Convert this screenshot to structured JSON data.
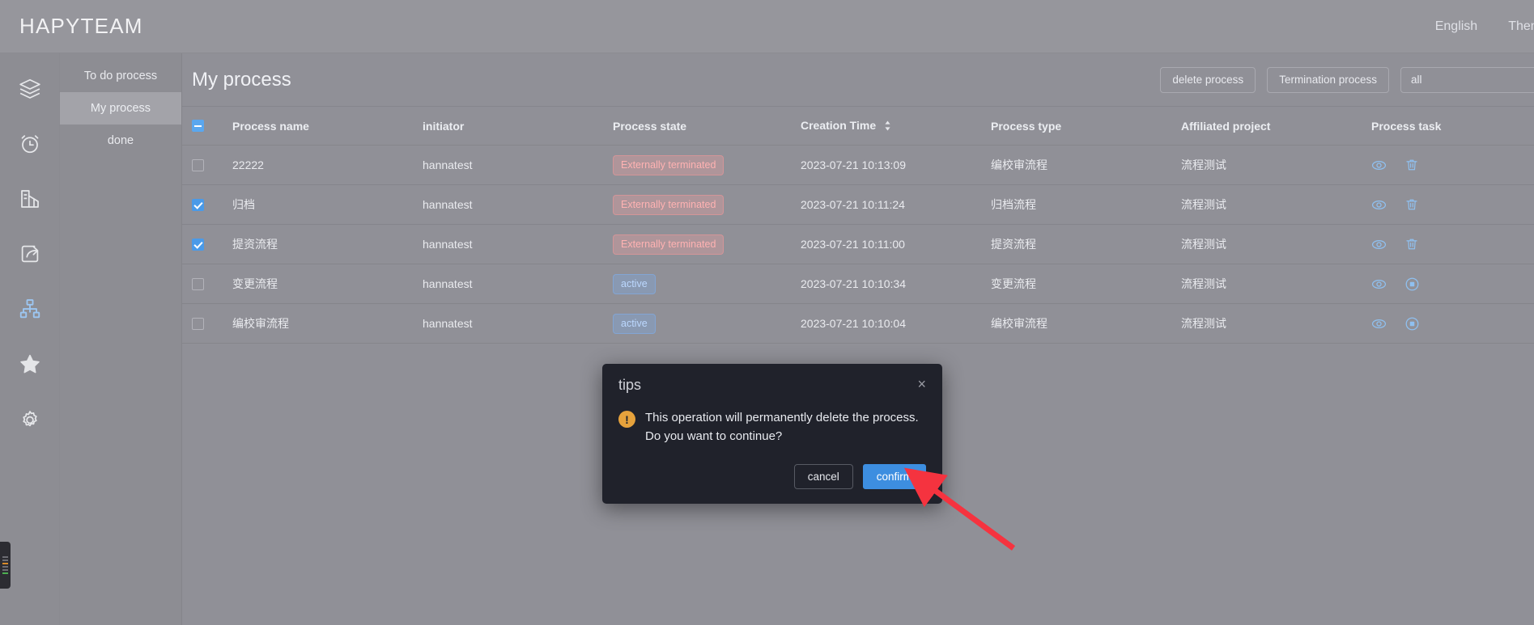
{
  "header": {
    "brand": "HAPYTEAM",
    "language_label": "English",
    "theme_label": "Theme"
  },
  "rail": {
    "items": [
      {
        "name": "layers-icon",
        "label": "layers"
      },
      {
        "name": "alarm-clock-icon",
        "label": "alarm clock"
      },
      {
        "name": "building-chart-icon",
        "label": "statistics"
      },
      {
        "name": "share-export-icon",
        "label": "share"
      },
      {
        "name": "sitemap-icon",
        "label": "process",
        "active": true
      },
      {
        "name": "star-icon",
        "label": "favorites"
      },
      {
        "name": "gear-icon",
        "label": "settings"
      }
    ]
  },
  "subnav": {
    "items": [
      {
        "label": "To do process",
        "active": false
      },
      {
        "label": "My process",
        "active": true
      },
      {
        "label": "done",
        "active": false
      }
    ]
  },
  "page": {
    "title": "My process",
    "actions": {
      "delete_process": "delete process",
      "termination_process": "Termination process"
    },
    "filter": {
      "selected": "all",
      "options": [
        "all"
      ]
    }
  },
  "table": {
    "columns": [
      "Process name",
      "initiator",
      "Process state",
      "Creation Time",
      "Process type",
      "Affiliated project",
      "Process task"
    ],
    "sort_column": "Creation Time",
    "header_checkbox_state": "indeterminate",
    "rows": [
      {
        "checked": false,
        "name": "22222",
        "initiator": "hannatest",
        "state": "Externally terminated",
        "state_kind": "terminated",
        "time": "2023-07-21 10:13:09",
        "type": "编校审流程",
        "project": "流程测试",
        "task_icons": [
          "eye-icon",
          "trash-icon"
        ]
      },
      {
        "checked": true,
        "name": "归档",
        "initiator": "hannatest",
        "state": "Externally terminated",
        "state_kind": "terminated",
        "time": "2023-07-21 10:11:24",
        "type": "归档流程",
        "project": "流程测试",
        "task_icons": [
          "eye-icon",
          "trash-icon"
        ]
      },
      {
        "checked": true,
        "name": "提资流程",
        "initiator": "hannatest",
        "state": "Externally terminated",
        "state_kind": "terminated",
        "time": "2023-07-21 10:11:00",
        "type": "提资流程",
        "project": "流程测试",
        "task_icons": [
          "eye-icon",
          "trash-icon"
        ]
      },
      {
        "checked": false,
        "name": "变更流程",
        "initiator": "hannatest",
        "state": "active",
        "state_kind": "active",
        "time": "2023-07-21 10:10:34",
        "type": "变更流程",
        "project": "流程测试",
        "task_icons": [
          "eye-icon",
          "stop-icon"
        ]
      },
      {
        "checked": false,
        "name": "编校审流程",
        "initiator": "hannatest",
        "state": "active",
        "state_kind": "active",
        "time": "2023-07-21 10:10:04",
        "type": "编校审流程",
        "project": "流程测试",
        "task_icons": [
          "eye-icon",
          "stop-icon"
        ]
      }
    ]
  },
  "modal": {
    "title": "tips",
    "close_icon": "×",
    "warning_icon": "!",
    "message": "This operation will permanently delete the process. Do you want to continue?",
    "cancel_label": "cancel",
    "confirm_label": "confirm"
  },
  "colors": {
    "accent": "#3d8ee0",
    "background": "#8e8e95",
    "panel": "#909097",
    "modal_bg": "#20222b",
    "warning": "#e6a23c",
    "terminated_text": "#ffb2b2",
    "active_text": "#bcd8ff",
    "annotation_arrow": "#f5333f"
  }
}
